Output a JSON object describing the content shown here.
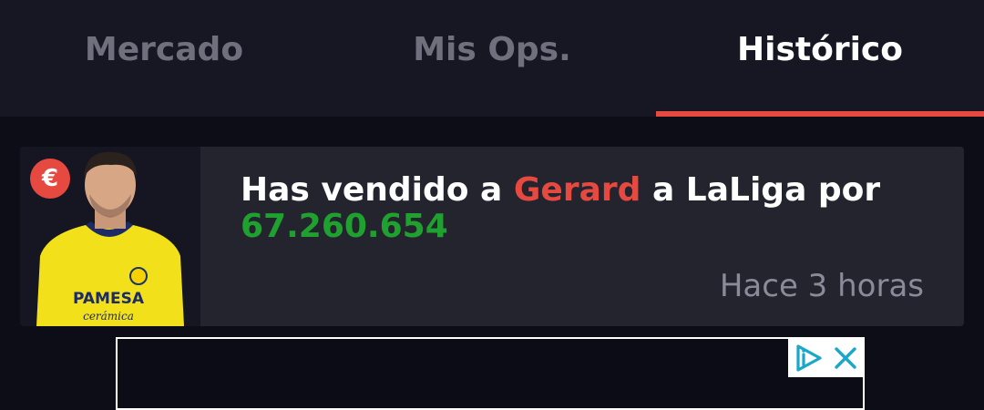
{
  "tabs": [
    {
      "label": "Mercado"
    },
    {
      "label": "Mis Ops."
    },
    {
      "label": "Histórico"
    }
  ],
  "activity": {
    "icon": "euro-icon",
    "badge_symbol": "€",
    "message_prefix": "Has vendido a ",
    "player_name": "Gerard",
    "message_middle": " a LaLiga por",
    "amount": "67.260.654",
    "time_ago": "Hace 3 horas"
  },
  "player_shirt": {
    "sponsor": "PAMESA",
    "sponsor_sub": "cerámica"
  },
  "colors": {
    "accent": "#e5493f",
    "positive": "#1fa12f",
    "background": "#0d0d17",
    "card": "#24242f"
  },
  "ad": {
    "icons": [
      "adchoices-icon",
      "close-icon"
    ]
  }
}
